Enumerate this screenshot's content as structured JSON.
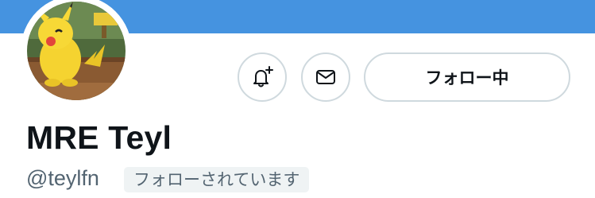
{
  "colors": {
    "banner": "#4593e0",
    "button_border": "#cfd9de",
    "text_primary": "#0f1419",
    "text_secondary": "#536471",
    "badge_bg": "#eff3f4"
  },
  "profile": {
    "display_name": "MRE Teyl",
    "handle": "@teylfn",
    "follows_you_label": "フォローされています"
  },
  "actions": {
    "notify_icon": "bell-plus-icon",
    "message_icon": "envelope-icon",
    "following_label": "フォロー中"
  }
}
